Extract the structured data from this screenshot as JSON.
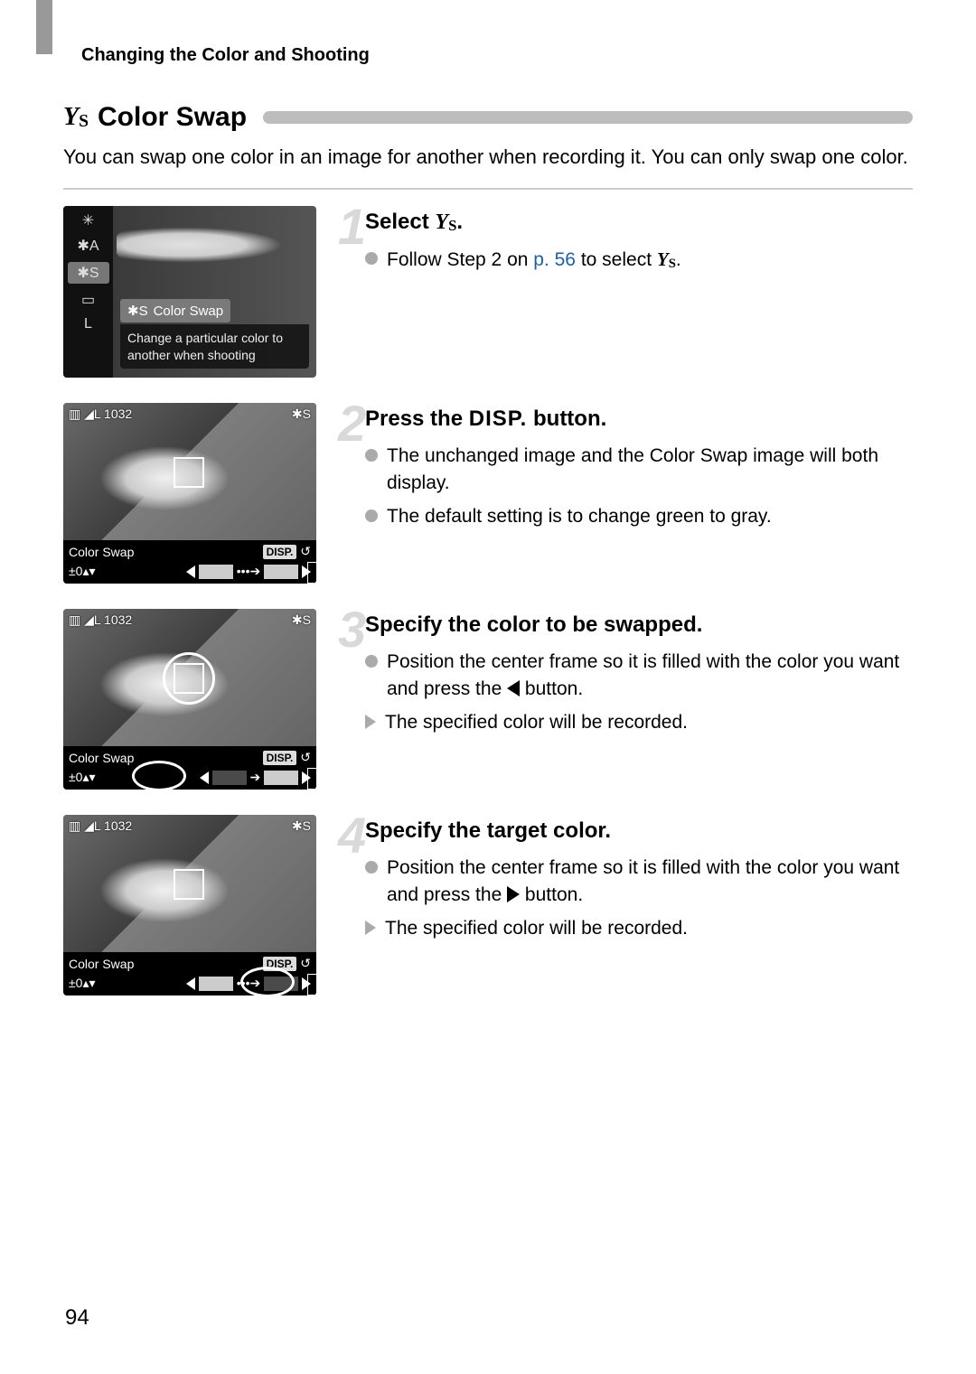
{
  "header": "Changing the Color and Shooting",
  "section": {
    "icon_name": "color-swap-icon",
    "icon_glyph": "Y",
    "icon_sub": "S",
    "title": "Color Swap"
  },
  "intro": "You can swap one color in an image for another when recording it. You can only swap one color.",
  "thumbs": {
    "menu": {
      "items": [
        "✳",
        "✱A",
        "✱S",
        "▭",
        "L"
      ],
      "sub_items": [
        "✱S",
        "🎨"
      ],
      "title_icon": "✱S",
      "title": "Color Swap",
      "desc": "Change a particular color to another when shooting"
    },
    "preview": {
      "top_left": "▥ ◢L 1032",
      "top_right": "✱S",
      "label": "Color Swap",
      "disp": "DISP.",
      "adjust": "±0▴▾",
      "dots": "•••➔"
    }
  },
  "steps": [
    {
      "num": "1",
      "title_pre": "Select ",
      "title_icon": "Y",
      "title_icon_sub": "S",
      "title_post": ".",
      "bullets": [
        {
          "pre": "Follow Step 2 on ",
          "link": "p. 56",
          "post": " to select ",
          "end_icon": true,
          "end": "."
        }
      ]
    },
    {
      "num": "2",
      "title_pre": "Press the ",
      "title_disp": "DISP.",
      "title_post": " button.",
      "bullets": [
        {
          "text": "The unchanged image and the Color Swap image will both display."
        },
        {
          "text": "The default setting is to change green to gray."
        }
      ]
    },
    {
      "num": "3",
      "title": "Specify the color to be swapped.",
      "bullets": [
        {
          "pre": "Position the center frame so it is filled with the color you want and press the ",
          "tri": "left",
          "post": " button."
        }
      ],
      "results": [
        "The specified color will be recorded."
      ]
    },
    {
      "num": "4",
      "title": "Specify the target color.",
      "bullets": [
        {
          "pre": "Position the center frame so it is filled with the color you want and press the ",
          "tri": "right",
          "post": " button."
        }
      ],
      "results": [
        "The specified color will be recorded."
      ]
    }
  ],
  "page_number": "94"
}
